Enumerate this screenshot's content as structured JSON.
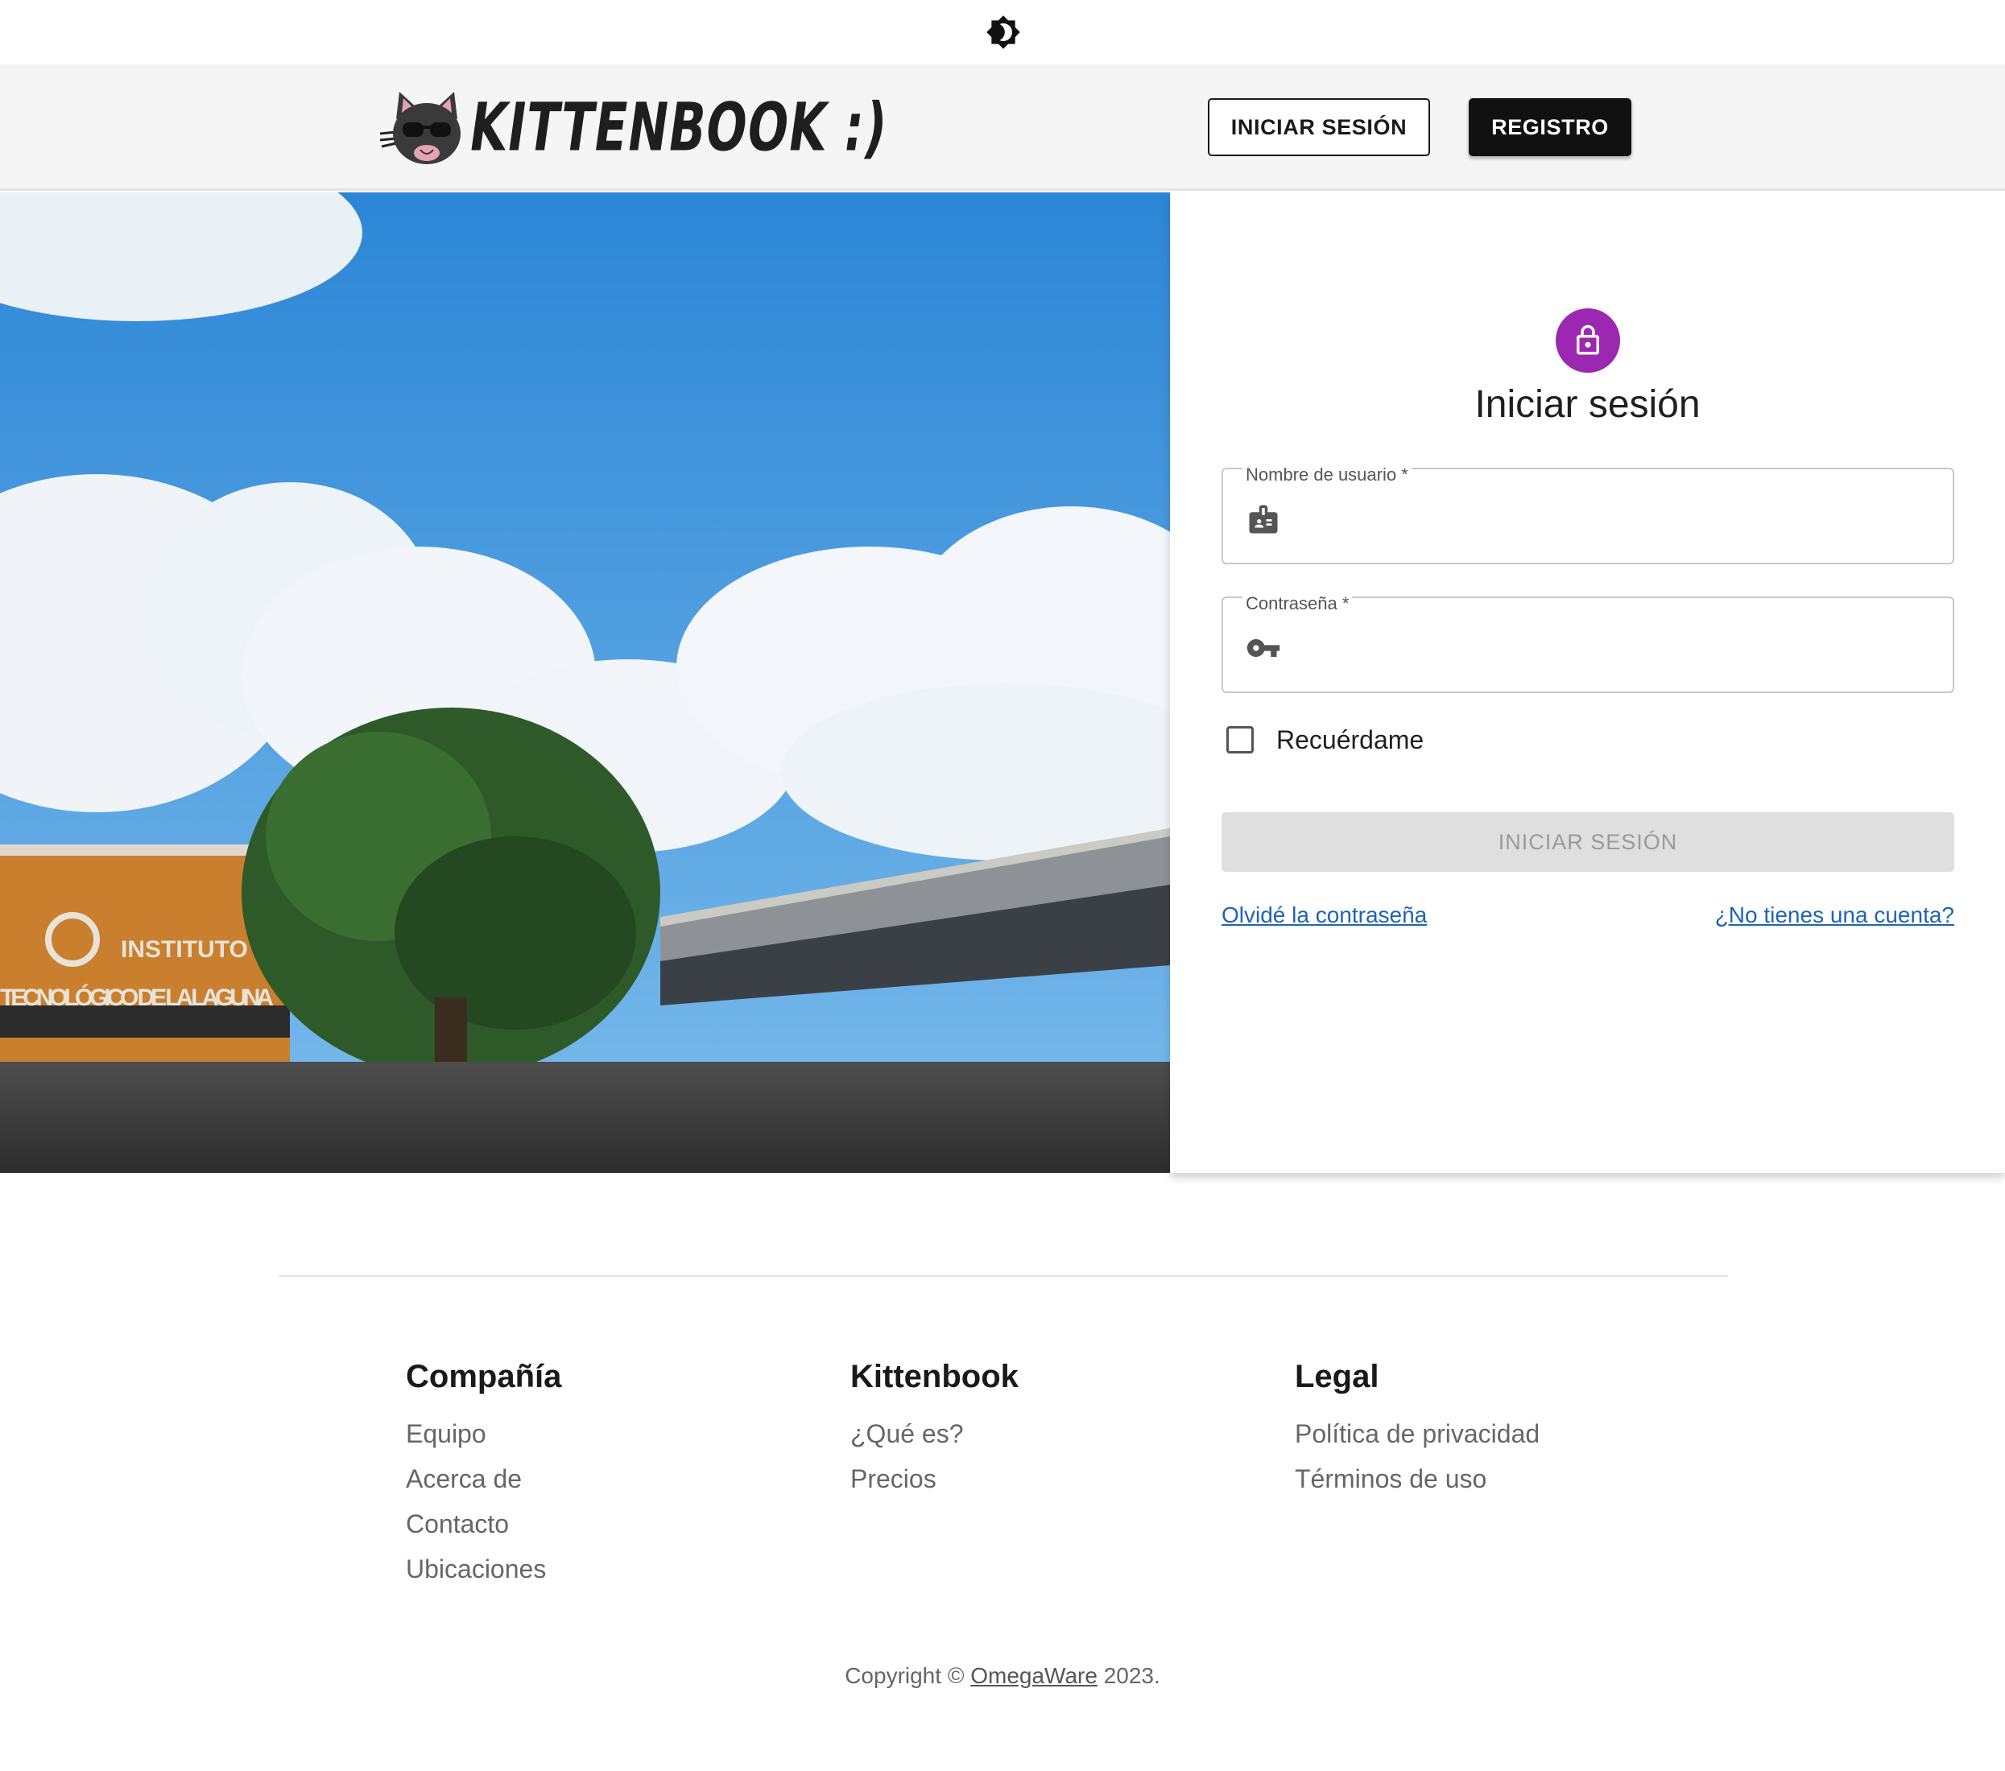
{
  "theme_toggle": {
    "icon": "brightness-icon"
  },
  "header": {
    "logo_text": "KITTENBOOK :)",
    "login_button": "INICIAR SESIÓN",
    "register_button": "REGISTRO"
  },
  "hero": {
    "sign_line1": "INSTITUTO",
    "sign_line2": "TECNOLÓGICO DE LA LAGUNA"
  },
  "login": {
    "title": "Iniciar sesión",
    "username_label": "Nombre de usuario *",
    "username_value": "",
    "password_label": "Contraseña *",
    "password_value": "",
    "remember_label": "Recuérdame",
    "remember_checked": false,
    "submit_label": "INICIAR SESIÓN",
    "forgot_link": "Olvidé la contraseña",
    "signup_link": "¿No tienes una cuenta?",
    "accent_color": "#9c27b0",
    "link_color": "#1f63b8"
  },
  "footer": {
    "columns": [
      {
        "title": "Compañía",
        "links": [
          "Equipo",
          "Acerca de",
          "Contacto",
          "Ubicaciones"
        ]
      },
      {
        "title": "Kittenbook",
        "links": [
          "¿Qué es?",
          "Precios"
        ]
      },
      {
        "title": "Legal",
        "links": [
          "Política de privacidad",
          "Términos de uso"
        ]
      }
    ],
    "copyright_prefix": "Copyright © ",
    "copyright_link": "OmegaWare",
    "copyright_suffix": " 2023."
  }
}
